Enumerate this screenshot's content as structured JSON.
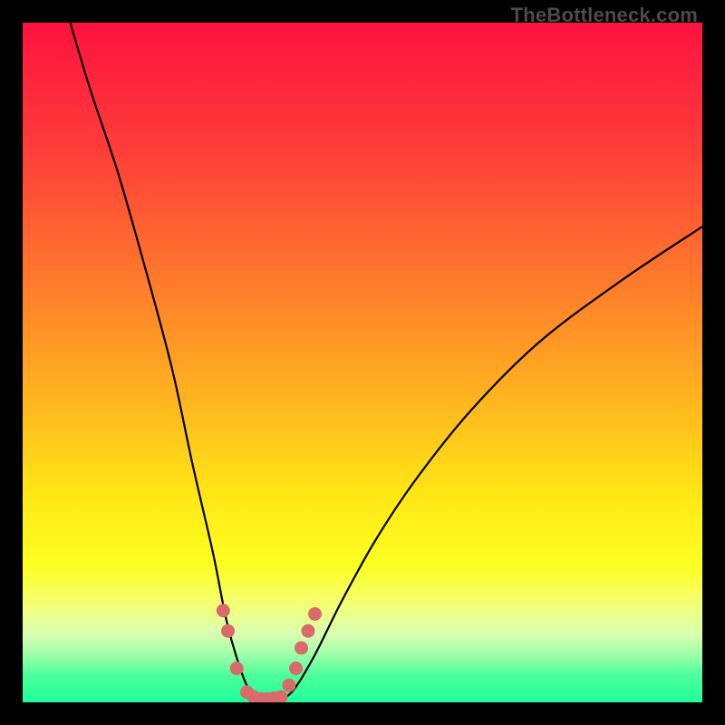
{
  "watermark": "TheBottleneck.com",
  "chart_data": {
    "type": "line",
    "title": "",
    "xlabel": "",
    "ylabel": "",
    "xlim": [
      0,
      100
    ],
    "ylim": [
      0,
      100
    ],
    "gradient_stops": [
      {
        "offset": 0,
        "color": "#ff123f"
      },
      {
        "offset": 18,
        "color": "#ff3b3a"
      },
      {
        "offset": 38,
        "color": "#ff7a2c"
      },
      {
        "offset": 55,
        "color": "#ffb31f"
      },
      {
        "offset": 70,
        "color": "#ffe815"
      },
      {
        "offset": 80,
        "color": "#fdff22"
      },
      {
        "offset": 86,
        "color": "#f2ff7a"
      },
      {
        "offset": 90,
        "color": "#d8ffb1"
      },
      {
        "offset": 93,
        "color": "#9effa9"
      },
      {
        "offset": 96,
        "color": "#4dff9a"
      },
      {
        "offset": 100,
        "color": "#1fff9a"
      }
    ],
    "series": [
      {
        "name": "left-branch",
        "x": [
          7,
          10,
          14,
          18,
          22,
          25,
          28,
          30,
          32,
          33.5,
          35
        ],
        "values": [
          100,
          90,
          78,
          64,
          49,
          35,
          22,
          12,
          5,
          1.5,
          0.2
        ]
      },
      {
        "name": "right-branch",
        "x": [
          38,
          40,
          43,
          47,
          52,
          58,
          66,
          76,
          88,
          100
        ],
        "values": [
          0.2,
          2,
          7,
          15,
          24,
          33,
          43,
          53,
          62,
          70
        ]
      }
    ],
    "markers": {
      "name": "valley-dots",
      "color": "#d86a6a",
      "x": [
        29.5,
        30.2,
        31.5,
        33.0,
        34.0,
        35.0,
        36.0,
        37.0,
        38.0,
        39.2,
        40.2,
        41.0,
        42.0,
        43.0
      ],
      "values": [
        13.5,
        10.5,
        5.0,
        1.5,
        0.8,
        0.5,
        0.5,
        0.6,
        0.8,
        2.5,
        5.0,
        8.0,
        10.5,
        13.0
      ]
    },
    "valley_x": 36,
    "valley_y": 0.3
  }
}
